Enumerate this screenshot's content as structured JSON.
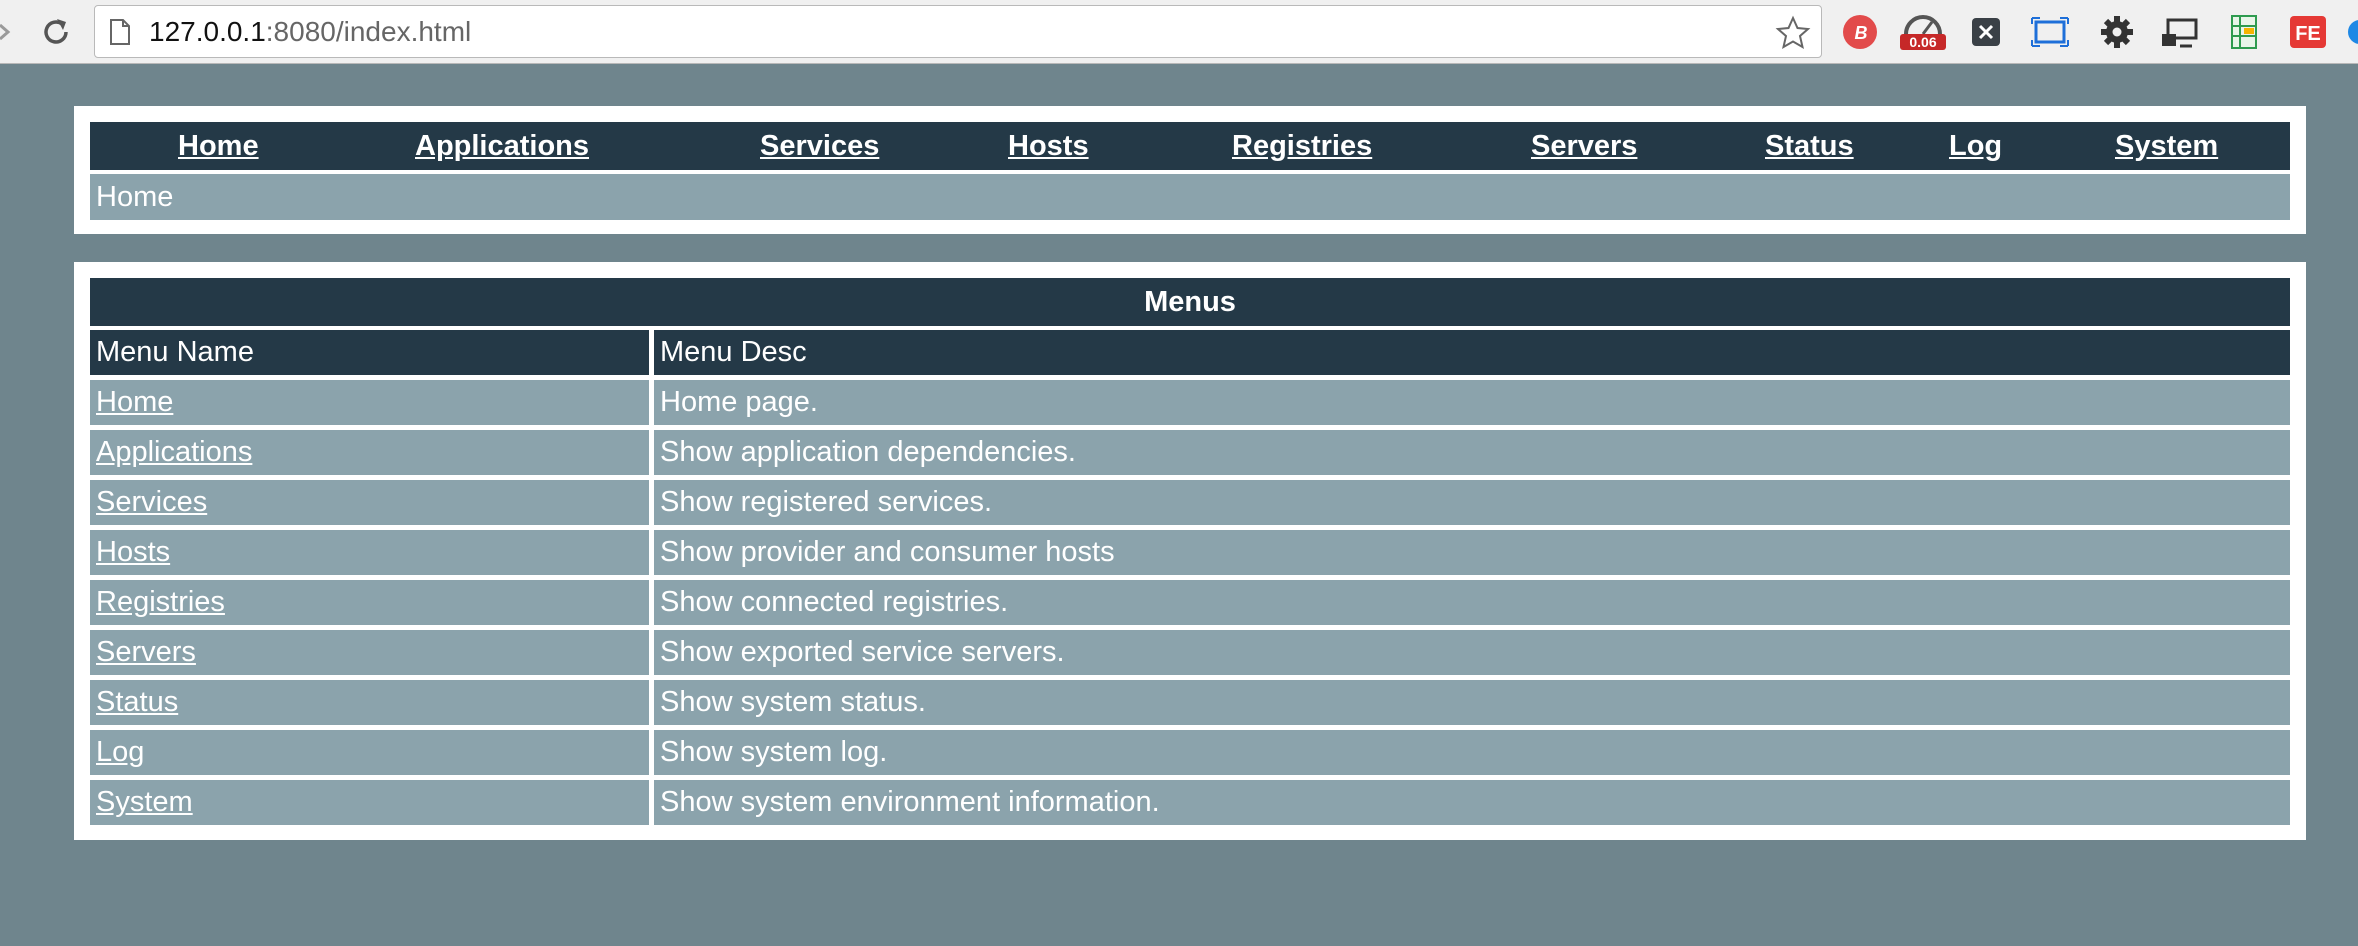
{
  "browser": {
    "url_host": "127.0.0.1",
    "url_rest": ":8080/index.html",
    "extensions": [
      {
        "name": "b-extension-icon",
        "color": "#e24b4b",
        "label": "B"
      },
      {
        "name": "speed-extension-icon",
        "color": "#c62828",
        "badge": "0.06"
      },
      {
        "name": "x-extension-icon",
        "color": "#3a4046",
        "label": "X"
      },
      {
        "name": "screenshot-extension-icon",
        "color": "#1e6fd9"
      },
      {
        "name": "settings-extension-icon",
        "color": "#333333"
      },
      {
        "name": "cast-extension-icon",
        "color": "#333333"
      },
      {
        "name": "sheet-extension-icon",
        "color": "#2e9b4f"
      },
      {
        "name": "fe-extension-icon",
        "color": "#e53935",
        "label": "FE"
      }
    ]
  },
  "colors": {
    "page_bg": "#6f858d",
    "dark_bar": "#243947",
    "light_bar": "#8ba3ac"
  },
  "topnav": {
    "items": [
      {
        "label": "Home"
      },
      {
        "label": "Applications"
      },
      {
        "label": "Services"
      },
      {
        "label": "Hosts"
      },
      {
        "label": "Registries"
      },
      {
        "label": "Servers"
      },
      {
        "label": "Status"
      },
      {
        "label": "Log"
      },
      {
        "label": "System"
      }
    ]
  },
  "breadcrumb": {
    "current": "Home"
  },
  "menus": {
    "title": "Menus",
    "columns": [
      "Menu Name",
      "Menu Desc"
    ],
    "rows": [
      {
        "name": "Home",
        "desc": "Home page."
      },
      {
        "name": "Applications",
        "desc": "Show application dependencies."
      },
      {
        "name": "Services",
        "desc": "Show registered services."
      },
      {
        "name": "Hosts",
        "desc": "Show provider and consumer hosts"
      },
      {
        "name": "Registries",
        "desc": "Show connected registries."
      },
      {
        "name": "Servers",
        "desc": "Show exported service servers."
      },
      {
        "name": "Status",
        "desc": "Show system status."
      },
      {
        "name": "Log",
        "desc": "Show system log."
      },
      {
        "name": "System",
        "desc": "Show system environment information."
      }
    ]
  }
}
